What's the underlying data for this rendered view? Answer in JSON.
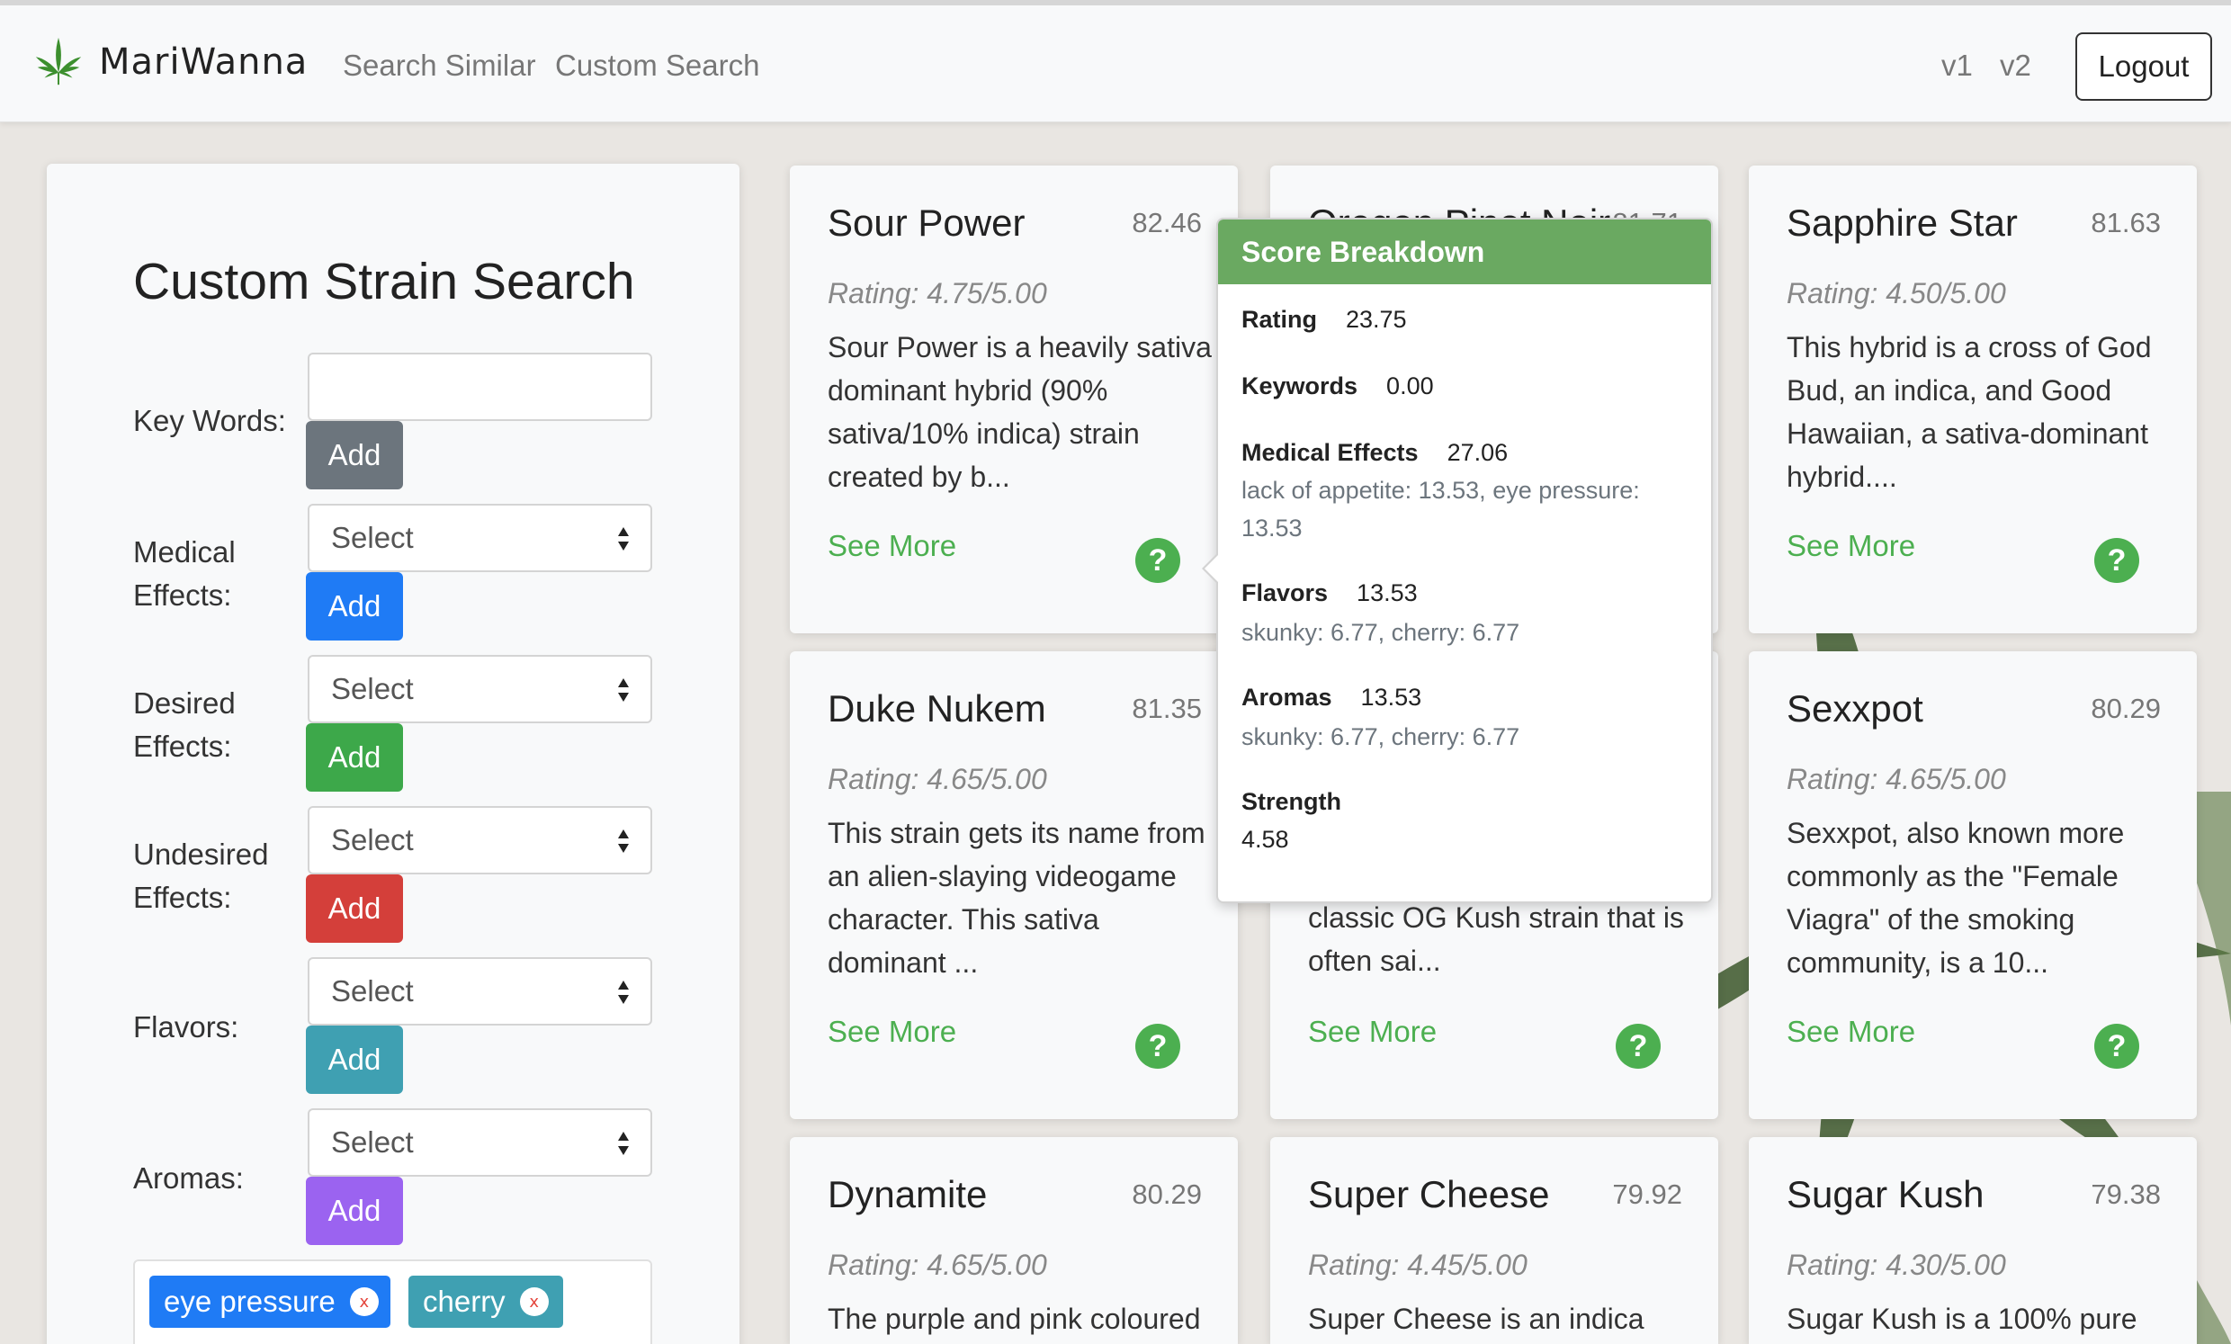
{
  "navbar": {
    "brand": "MariWanna",
    "links": [
      "Search Similar",
      "Custom Search"
    ],
    "versions": [
      "v1",
      "v2"
    ],
    "logout": "Logout"
  },
  "search_panel": {
    "title": "Custom Strain Search",
    "keywords_label": "Key Words:",
    "medical_label": "Medical Effects:",
    "desired_label": "Desired Effects:",
    "undesired_label": "Undesired Effects:",
    "flavors_label": "Flavors:",
    "aromas_label": "Aromas:",
    "select_placeholder": "Select",
    "add_label": "Add",
    "colors": {
      "keywords": "#6c757d",
      "medical": "#1f7bf5",
      "desired": "#3da84a",
      "undesired": "#d43f3a",
      "flavors": "#3fa0b2",
      "aromas": "#9b63f0"
    },
    "tags": [
      {
        "label": "eye pressure",
        "color": "#1f7bf5"
      },
      {
        "label": "cherry",
        "color": "#3fa0b2"
      }
    ]
  },
  "cards": [
    {
      "name": "Sour Power",
      "score": "82.46",
      "rating": "Rating: 4.75/5.00",
      "desc": "Sour Power is a heavily sativa dominant hybrid (90% sativa/10% indica) strain created by b...",
      "more": "See More"
    },
    {
      "name": "Oregon Pinot Noir",
      "score": "81.71",
      "rating": "",
      "desc": "",
      "more": ""
    },
    {
      "name": "Sapphire Star",
      "score": "81.63",
      "rating": "Rating: 4.50/5.00",
      "desc": "This hybrid is a cross of God Bud, an indica, and Good Hawaiian, a sativa-dominant hybrid....",
      "more": "See More"
    },
    {
      "name": "Duke Nukem",
      "score": "81.35",
      "rating": "Rating: 4.65/5.00",
      "desc": "This strain gets its name from an alien-slaying videogame character. This sativa dominant ...",
      "more": "See More"
    },
    {
      "name": "",
      "score": "",
      "rating": "",
      "desc": "classic OG Kush strain that is often sai...",
      "more": "See More"
    },
    {
      "name": "Sexxpot",
      "score": "80.29",
      "rating": "Rating: 4.65/5.00",
      "desc": "Sexxpot, also known more commonly as the \"Female Viagra\" of the smoking community, is a 10...",
      "more": "See More"
    },
    {
      "name": "Dynamite",
      "score": "80.29",
      "rating": "Rating: 4.65/5.00",
      "desc": "The purple and pink coloured",
      "more": ""
    },
    {
      "name": "Super Cheese",
      "score": "79.92",
      "rating": "Rating: 4.45/5.00",
      "desc": "Super Cheese is an indica",
      "more": ""
    },
    {
      "name": "Sugar Kush",
      "score": "79.38",
      "rating": "Rating: 4.30/5.00",
      "desc": "Sugar Kush is a 100% pure",
      "more": ""
    }
  ],
  "popover": {
    "title": "Score Breakdown",
    "rating_label": "Rating",
    "rating_value": "23.75",
    "keywords_label": "Keywords",
    "keywords_value": "0.00",
    "medical_label": "Medical Effects",
    "medical_value": "27.06",
    "medical_detail": "lack of appetite: 13.53, eye pressure: 13.53",
    "flavors_label": "Flavors",
    "flavors_value": "13.53",
    "flavors_detail": "skunky: 6.77, cherry: 6.77",
    "aromas_label": "Aromas",
    "aromas_value": "13.53",
    "aromas_detail": "skunky: 6.77, cherry: 6.77",
    "strength_label": "Strength",
    "strength_value": "4.58"
  }
}
